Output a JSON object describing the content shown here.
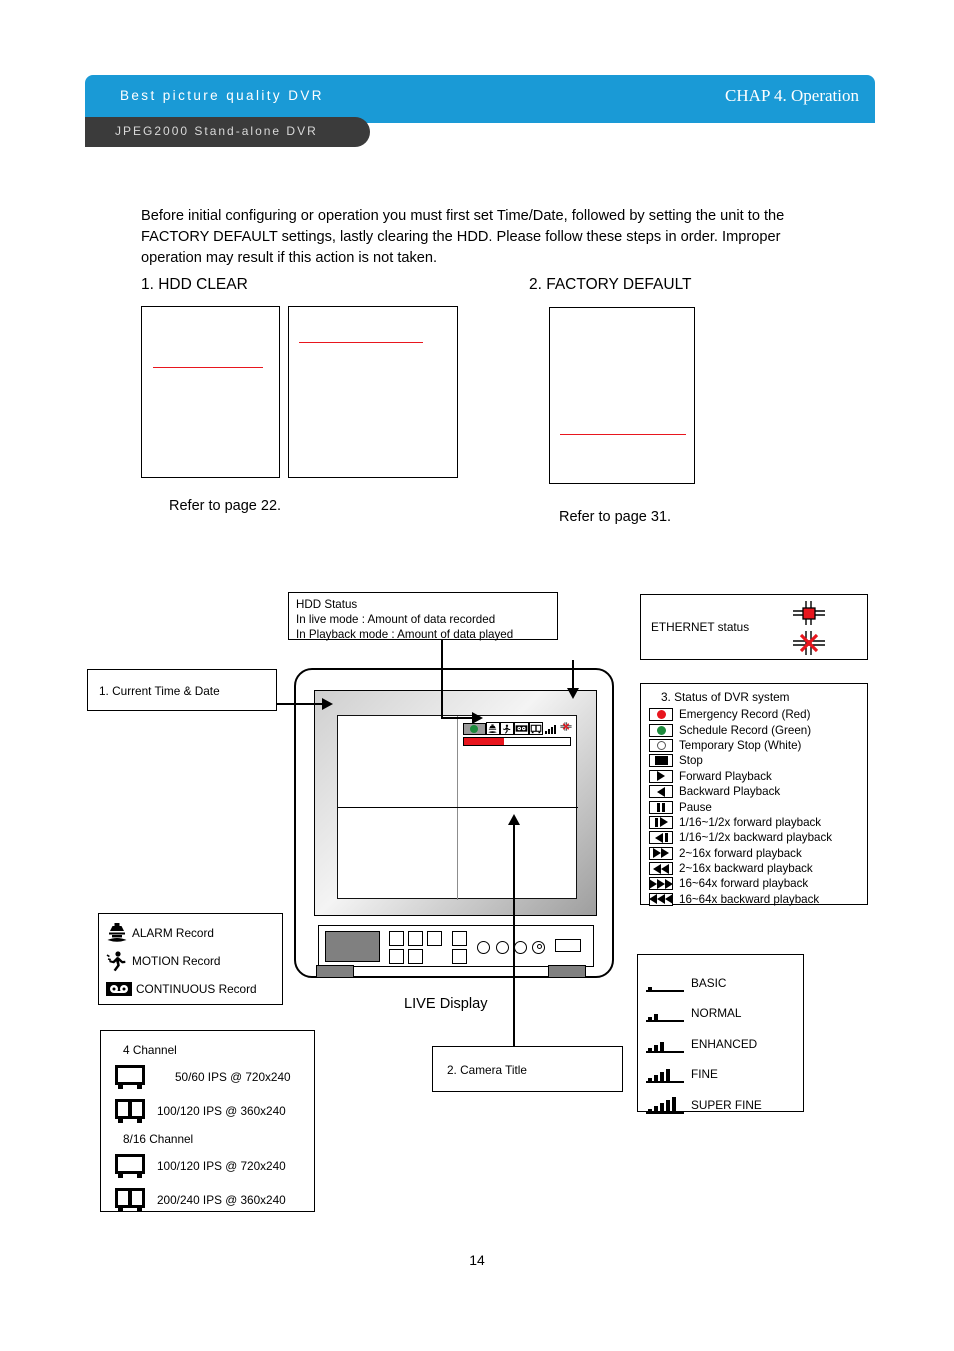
{
  "header": {
    "brand_title": "Best picture quality DVR",
    "chapter": "CHAP 4. Operation",
    "product_tab": "JPEG2000 Stand-alone DVR",
    "accent_color": "#1a9ad6",
    "tab_color": "#3b3b3b"
  },
  "intro": {
    "paragraph": "Before initial configuring or operation you must first set Time/Date, followed by setting the unit to the FACTORY DEFAULT settings, lastly clearing the HDD. Please follow these steps in order. Improper operation may result if this action is not taken.",
    "step1": "1. HDD CLEAR",
    "step2": "2. FACTORY DEFAULT",
    "refer_left": "Refer to page 22.",
    "refer_right": "Refer to page 31.",
    "highlight_color": "#e8161e"
  },
  "callouts": {
    "hdd_status": {
      "line1": "HDD Status",
      "line2": "In live mode : Amount of data recorded",
      "line3": "In Playback mode : Amount of data played"
    },
    "ethernet": {
      "label": "ETHERNET status"
    },
    "time_date": {
      "label": "1. Current Time & Date"
    },
    "camera_title": {
      "label": "2. Camera Title"
    },
    "live_display": {
      "label": "LIVE Display"
    }
  },
  "dvr_status": {
    "title": "3. Status of DVR system",
    "items": [
      {
        "icon": "record-red-icon",
        "label": "Emergency Record (Red)"
      },
      {
        "icon": "record-green-icon",
        "label": "Schedule Record (Green)"
      },
      {
        "icon": "record-white-icon",
        "label": "Temporary Stop (White)"
      },
      {
        "icon": "stop-icon",
        "label": "Stop"
      },
      {
        "icon": "play-forward-icon",
        "label": "Forward Playback"
      },
      {
        "icon": "play-backward-icon",
        "label": "Backward Playback"
      },
      {
        "icon": "pause-icon",
        "label": "Pause"
      },
      {
        "icon": "slow-forward-icon",
        "label": "1/16~1/2x forward playback"
      },
      {
        "icon": "slow-backward-icon",
        "label": "1/16~1/2x backward playback"
      },
      {
        "icon": "fast-forward-icon",
        "label": "2~16x forward playback"
      },
      {
        "icon": "fast-backward-icon",
        "label": "2~16x backward playback"
      },
      {
        "icon": "fastest-forward-icon",
        "label": "16~64x forward playback"
      },
      {
        "icon": "fastest-backward-icon",
        "label": "16~64x backward playback"
      }
    ],
    "colors": {
      "red": "#e8161e",
      "green": "#1c8a3c",
      "white": "#ffffff"
    }
  },
  "record_types": [
    {
      "icon": "alarm-icon",
      "label": "ALARM Record"
    },
    {
      "icon": "motion-icon",
      "label": "MOTION Record"
    },
    {
      "icon": "continuous-icon",
      "label": "CONTINUOUS Record"
    }
  ],
  "channel_specs": [
    {
      "heading": "4 Channel",
      "rows": [
        {
          "icon": "screen-full-icon",
          "label": "50/60 IPS @ 720x240"
        },
        {
          "icon": "screen-split-icon",
          "label": "100/120 IPS @ 360x240"
        }
      ]
    },
    {
      "heading": "8/16 Channel",
      "rows": [
        {
          "icon": "screen-full-icon",
          "label": "100/120 IPS @ 720x240"
        },
        {
          "icon": "screen-split-icon",
          "label": "200/240 IPS @ 360x240"
        }
      ]
    }
  ],
  "quality_levels": [
    {
      "bars": 1,
      "label": "BASIC"
    },
    {
      "bars": 2,
      "label": "NORMAL"
    },
    {
      "bars": 3,
      "label": "ENHANCED"
    },
    {
      "bars": 4,
      "label": "FINE"
    },
    {
      "bars": 5,
      "label": "SUPER FINE"
    }
  ],
  "page": {
    "number": "14"
  }
}
